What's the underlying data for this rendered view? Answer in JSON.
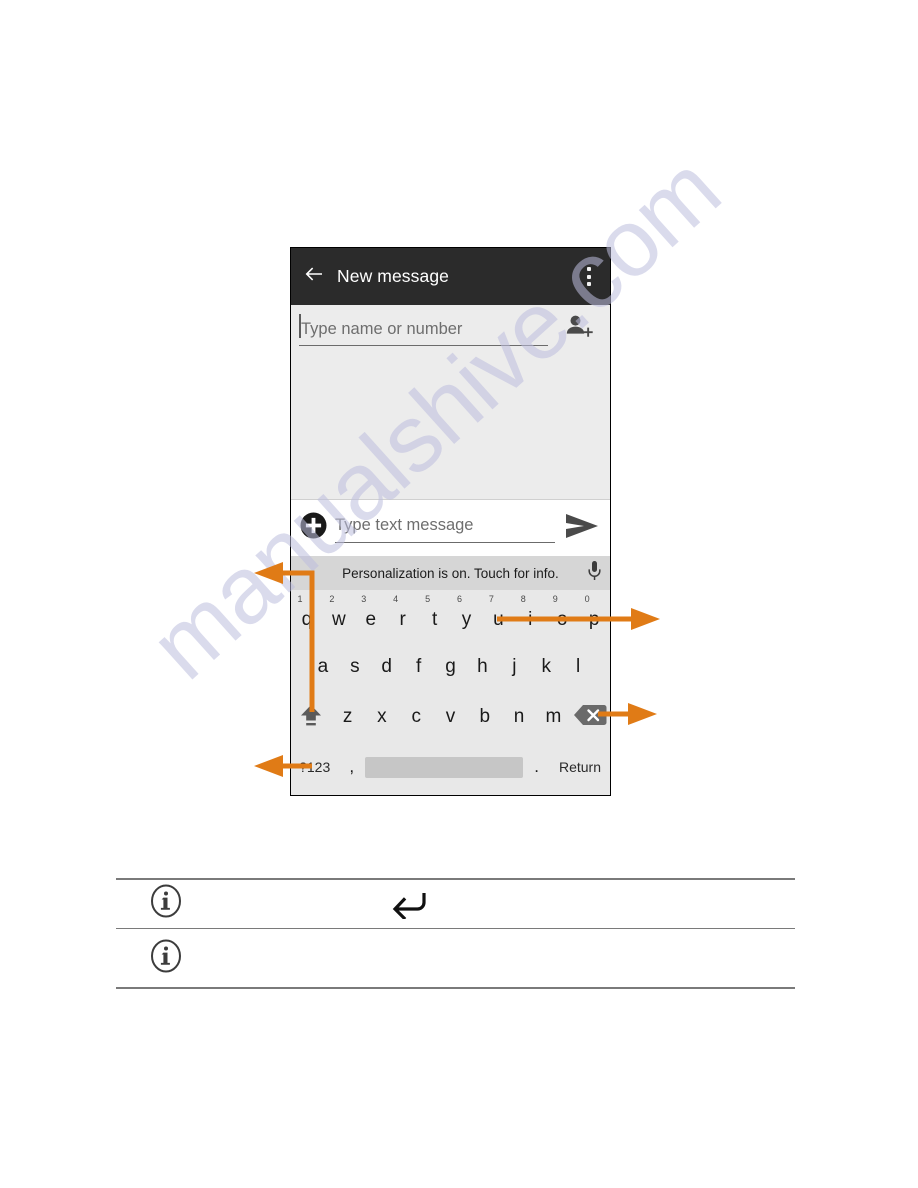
{
  "watermark": {
    "text": "manualshive.com"
  },
  "phone": {
    "titlebar": {
      "back_icon": "arrow-back-icon",
      "title": "New message",
      "overflow_icon": "overflow-menu-icon"
    },
    "recipient": {
      "placeholder": "Type name or number",
      "value": "",
      "add_contact_icon": "add-contact-icon"
    },
    "compose": {
      "attach_icon": "add-attachment-icon",
      "placeholder": "Type text message",
      "value": "",
      "send_icon": "send-icon"
    },
    "suggestion_bar": {
      "text": "Personalization is on. Touch for info.",
      "mic_icon": "microphone-icon"
    },
    "keyboard": {
      "row1": [
        {
          "key": "q",
          "hint": "1"
        },
        {
          "key": "w",
          "hint": "2"
        },
        {
          "key": "e",
          "hint": "3"
        },
        {
          "key": "r",
          "hint": "4"
        },
        {
          "key": "t",
          "hint": "5"
        },
        {
          "key": "y",
          "hint": "6"
        },
        {
          "key": "u",
          "hint": "7"
        },
        {
          "key": "i",
          "hint": "8"
        },
        {
          "key": "o",
          "hint": "9"
        },
        {
          "key": "p",
          "hint": "0"
        }
      ],
      "row2": [
        "a",
        "s",
        "d",
        "f",
        "g",
        "h",
        "j",
        "k",
        "l"
      ],
      "row3": [
        "z",
        "x",
        "c",
        "v",
        "b",
        "n",
        "m"
      ],
      "shift_icon": "shift-key-icon",
      "backspace_icon": "backspace-key-icon",
      "row4": {
        "symbols_label": "?123",
        "comma_label": ",",
        "space_label": "",
        "period_label": ".",
        "return_label": "Return"
      }
    }
  },
  "annotations": {
    "color": "#e07b16",
    "callouts": [
      {
        "name": "suggestion-bar-callout",
        "target": "shift-key"
      },
      {
        "name": "letters-row-callout",
        "target": "keyboard-letters"
      },
      {
        "name": "backspace-callout",
        "target": "backspace-key"
      },
      {
        "name": "symbols-key-callout",
        "target": "symbols-key"
      }
    ]
  },
  "notes": {
    "rows": [
      {
        "icon": "info-icon",
        "glyph": "return-arrow-icon",
        "text": ""
      },
      {
        "icon": "info-icon",
        "glyph": "",
        "text": ""
      }
    ]
  }
}
